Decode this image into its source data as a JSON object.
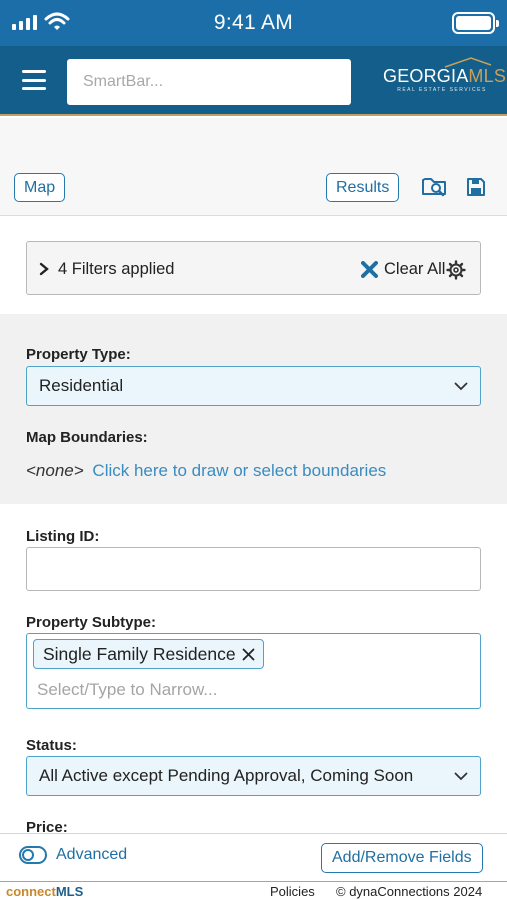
{
  "status_bar": {
    "time": "9:41 AM"
  },
  "header": {
    "search_placeholder": "SmartBar...",
    "logo_main": "GEORGIA",
    "logo_accent": "MLS",
    "logo_sub": "REAL ESTATE SERVICES"
  },
  "toolbar": {
    "map_label": "Map",
    "results_label": "Results",
    "icons": [
      "search-map-icon",
      "save-icon"
    ]
  },
  "filters": {
    "summary": "4 Filters applied",
    "clear_label": "Clear All"
  },
  "form": {
    "property_type": {
      "label": "Property Type:",
      "value": "Residential"
    },
    "map_boundaries": {
      "label": "Map Boundaries:",
      "none": "<none>",
      "link": "Click here to draw or select boundaries"
    },
    "listing_id": {
      "label": "Listing ID:",
      "value": ""
    },
    "property_subtype": {
      "label": "Property Subtype:",
      "chip": "Single Family Residence",
      "placeholder": "Select/Type to Narrow..."
    },
    "status": {
      "label": "Status:",
      "value": "All Active except Pending Approval, Coming Soon"
    },
    "price": {
      "label": "Price:"
    }
  },
  "footer": {
    "advanced_label": "Advanced",
    "add_remove_label": "Add/Remove Fields",
    "brand_a": "connect",
    "brand_b": "MLS",
    "policies": "Policies",
    "copyright": "© dynaConnections 2024"
  },
  "colors": {
    "header_blue": "#135e8a",
    "status_blue": "#1c6ea8",
    "accent_blue": "#2479ad",
    "gold": "#c6a15b"
  }
}
